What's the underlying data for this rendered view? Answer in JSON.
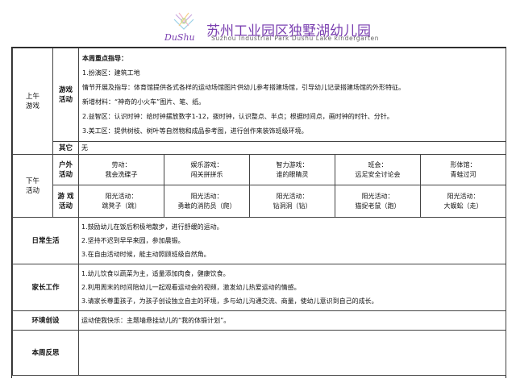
{
  "header": {
    "logo_text": "DuShu",
    "school_name": "苏州工业园区独墅湖幼儿园",
    "school_name_en": "Suzhou Industrial Park Dushu Lake kindergarten"
  },
  "morning": {
    "label_line1": "上午",
    "label_line2": "游戏",
    "game_label_line1": "游戏",
    "game_label_line2": "活动",
    "heading": "本周重点指导：",
    "lines": [
      "1.扮演区：建筑工地",
      "情节开展及指导：体育馆提供各式各样的运动场馆图片供幼儿参考搭建场馆，引导幼儿记录搭建场馆的外形特征。",
      "新增材料：“神奇的小火车”图片、笔、纸。",
      "2.益智区：认识时钟：给时钟摆放数字1-12，拨时钟，认识整点、半点；根据时间点，画时钟的时针、分针。",
      "3.美工区：提供树枝、树叶等自然物和成品参考图，进行创作来装饰班级环境。"
    ],
    "other_label": "其它",
    "other_value": "无"
  },
  "afternoon": {
    "label_line1": "下午",
    "label_line2": "活动",
    "outdoor_label_line1": "户外",
    "outdoor_label_line2": "活动",
    "outdoor": [
      {
        "type": "劳动：",
        "name": "我会洗碟子"
      },
      {
        "type": "娱乐游戏：",
        "name": "闯关拼拼乐"
      },
      {
        "type": "智力游戏：",
        "name": "谁的眼睛灵"
      },
      {
        "type": "班会：",
        "name": "远足安全讨论会"
      },
      {
        "type": "形体馆：",
        "name": "青蛙过河"
      }
    ],
    "game_label_line1": "游 戏",
    "game_label_line2": "活动",
    "games": [
      {
        "type": "阳光活动：",
        "name": "跳凳子（跳）"
      },
      {
        "type": "阳光活动：",
        "name": "勇敢的消防员（爬）"
      },
      {
        "type": "阳光活动：",
        "name": "钻洞洞（钻）"
      },
      {
        "type": "阳光活动：",
        "name": "猫捉老鼠（跑）"
      },
      {
        "type": "阳光活动：",
        "name": "大蜈蚣（走）"
      }
    ]
  },
  "daily_life": {
    "label": "日常生活",
    "lines": [
      "1.鼓励幼儿在饭后积极地散步，进行舒缓的运动。",
      "2.坚持不迟到早早来园，参加晨锻。",
      "3.在自由活动时候，能主动照顾班级自然角。"
    ]
  },
  "parents": {
    "label": "家长工作",
    "lines": [
      "1.幼儿饮食以蔬菜为主，适量添加肉食，健康饮食。",
      "2.利用周末的时间陪幼儿一起观看运动会的视频，激发幼儿热爱运动的情感。",
      "3.请家长尊重孩子，为孩子创设独立自主的环境，多与幼儿沟通交流、商量，使幼儿意识到自己的成长。"
    ]
  },
  "environment": {
    "label": "环境创设",
    "text": "运动使我快乐：主题墙悬挂幼儿的“我的体锻计划”。"
  },
  "reflection": {
    "label": "本周反思",
    "text": ""
  },
  "colors": {
    "brand_purple": "#7a3fb0",
    "brand_green": "#7bb33a",
    "brand_orange": "#e89a2a",
    "border": "#444444"
  }
}
